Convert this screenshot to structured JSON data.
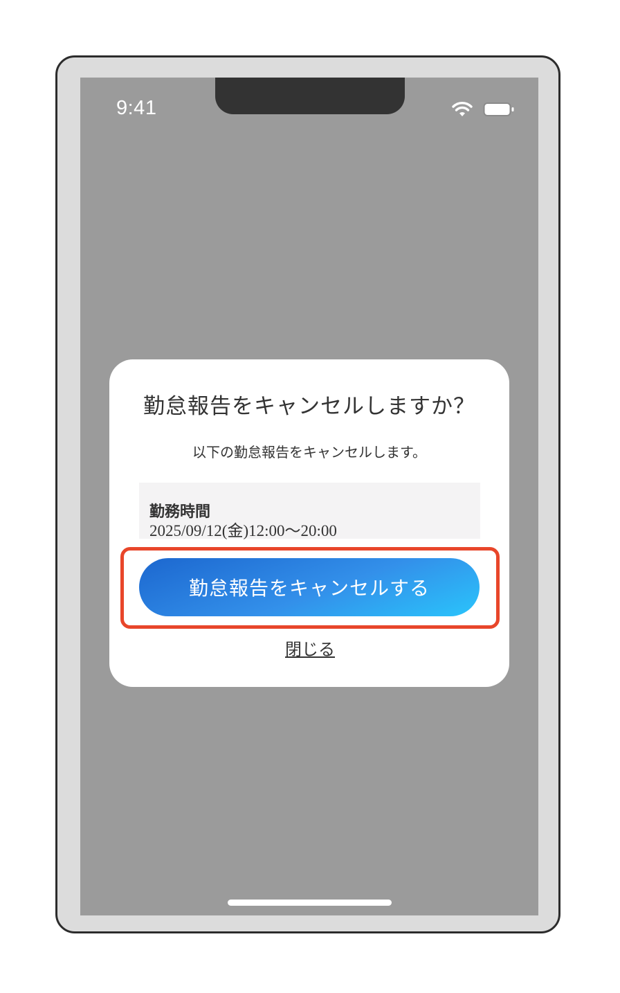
{
  "status_bar": {
    "time": "9:41",
    "wifi_icon": "wifi-icon",
    "battery_icon": "battery-icon"
  },
  "dialog": {
    "title": "勤怠報告をキャンセルしますか？",
    "message": "以下の勤怠報告をキャンセルします。",
    "info_label": "勤務時間",
    "info_value": "2025/09/12(金)12:00〜20:00",
    "primary_button_label": "勤怠報告をキャンセルする",
    "close_label": "閉じる"
  },
  "colors": {
    "overlay": "#9b9b9b",
    "button_gradient_start": "#1c67cf",
    "button_gradient_end": "#2ac4fb",
    "highlight": "#e8462a",
    "info_background": "#f4f3f4"
  }
}
